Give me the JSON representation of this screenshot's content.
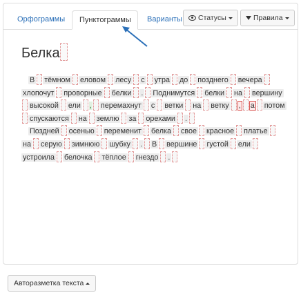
{
  "tabs": [
    {
      "label": "Орфограммы"
    },
    {
      "label": "Пунктограммы"
    },
    {
      "label": "Варианты"
    }
  ],
  "buttons": {
    "statuses": "Статусы",
    "rules": "Правила",
    "autolayout": "Авторазметка текста"
  },
  "title": "Белка",
  "paragraphs": [
    [
      "В",
      "тёмном",
      "еловом",
      "лесу",
      "с",
      "утра",
      "до",
      "позднего",
      "вечера",
      "хлопочут",
      "проворные",
      "белки",
      ".",
      "Поднимутся",
      "белки",
      "на",
      "вершину",
      "высокой",
      "ели",
      ",",
      "перемахнут",
      "с",
      "ветки",
      "на",
      "ветку",
      ",",
      "а",
      "потом",
      "спускаются",
      "на",
      "землю",
      "за",
      "орехами",
      "."
    ],
    [
      "Поздней",
      "осенью",
      "переменит",
      "белка",
      "свое",
      "красное",
      "платье",
      "на",
      "серую",
      "зимнюю",
      "шубку",
      ".",
      "В",
      "вершине",
      "густой",
      "ели",
      "устроила",
      "белочка",
      "тёплое",
      "гнездо",
      "."
    ]
  ],
  "colors": {
    "link": "#2a6fb8",
    "arrow": "#2a6fb8",
    "gap_border": "#e39a9a",
    "selected_border": "#d9534f"
  }
}
